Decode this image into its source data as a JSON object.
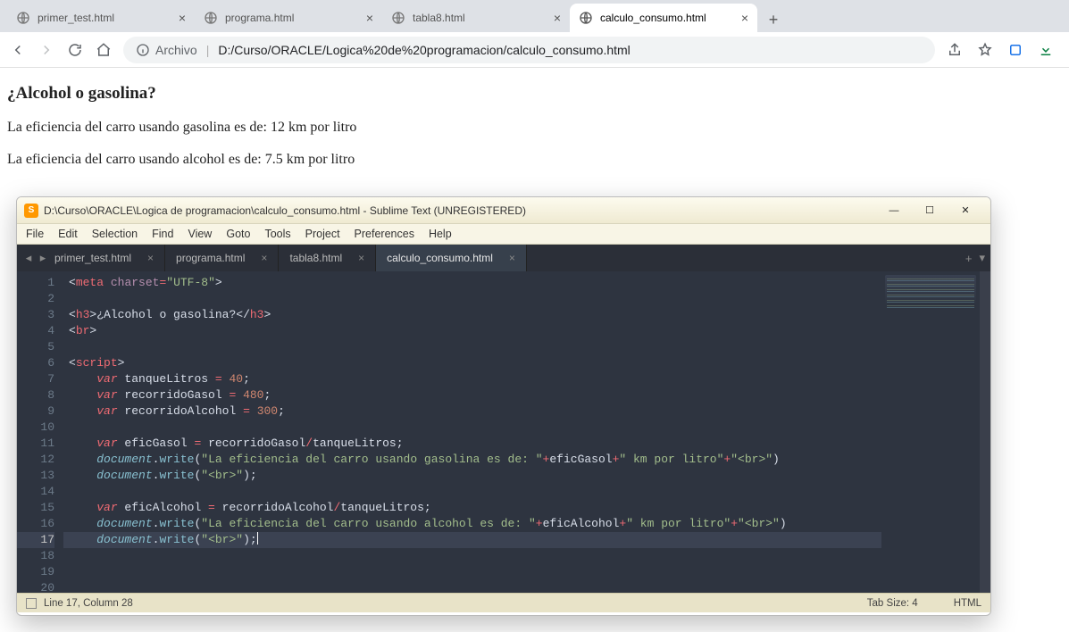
{
  "browser": {
    "tabs": [
      {
        "title": "primer_test.html",
        "active": false
      },
      {
        "title": "programa.html",
        "active": false
      },
      {
        "title": "tabla8.html",
        "active": false
      },
      {
        "title": "calculo_consumo.html",
        "active": true
      }
    ],
    "address_prefix": "Archivo",
    "address_path": "D:/Curso/ORACLE/Logica%20de%20programacion/calculo_consumo.html"
  },
  "page": {
    "heading": "¿Alcohol o gasolina?",
    "line1": "La eficiencia del carro usando gasolina es de: 12 km por litro",
    "line2": "La eficiencia del carro usando alcohol es de: 7.5 km por litro"
  },
  "sublime": {
    "title": "D:\\Curso\\ORACLE\\Logica de programacion\\calculo_consumo.html - Sublime Text (UNREGISTERED)",
    "menu": [
      "File",
      "Edit",
      "Selection",
      "Find",
      "View",
      "Goto",
      "Tools",
      "Project",
      "Preferences",
      "Help"
    ],
    "tabs": [
      {
        "title": "primer_test.html",
        "active": false
      },
      {
        "title": "programa.html",
        "active": false
      },
      {
        "title": "tabla8.html",
        "active": false
      },
      {
        "title": "calculo_consumo.html",
        "active": true
      }
    ],
    "status_left": "Line 17, Column 28",
    "status_tab": "Tab Size: 4",
    "status_lang": "HTML",
    "code": {
      "l1": {
        "a": "<",
        "b": "meta",
        "c": " ",
        "d": "charset",
        "e": "=",
        "f": "\"UTF-8\"",
        "g": ">"
      },
      "l3": {
        "a": "<",
        "b": "h3",
        "c": ">",
        "d": "¿Alcohol o gasolina?",
        "e": "</",
        "f": "h3",
        "g": ">"
      },
      "l4": {
        "a": "<",
        "b": "br",
        "c": ">"
      },
      "l6": {
        "a": "<",
        "b": "script",
        "c": ">"
      },
      "l7": {
        "a": "    ",
        "b": "var",
        "c": " tanqueLitros ",
        "d": "=",
        "e": " ",
        "f": "40",
        "g": ";"
      },
      "l8": {
        "a": "    ",
        "b": "var",
        "c": " recorridoGasol ",
        "d": "=",
        "e": " ",
        "f": "480",
        "g": ";"
      },
      "l9": {
        "a": "    ",
        "b": "var",
        "c": " recorridoAlcohol ",
        "d": "=",
        "e": " ",
        "f": "300",
        "g": ";"
      },
      "l11": {
        "a": "    ",
        "b": "var",
        "c": " eficGasol ",
        "d": "=",
        "e": " recorridoGasol",
        "f": "/",
        "g": "tanqueLitros;"
      },
      "l12": {
        "a": "    ",
        "b": "document",
        "c": ".",
        "d": "write",
        "e": "(",
        "f": "\"La eficiencia del carro usando gasolina es de: \"",
        "g": "+",
        "h": "eficGasol",
        "i": "+",
        "j": "\" km por litro\"",
        "k": "+",
        "l": "\"<br>\"",
        "m": ")"
      },
      "l13": {
        "a": "    ",
        "b": "document",
        "c": ".",
        "d": "write",
        "e": "(",
        "f": "\"<br>\"",
        "g": ");"
      },
      "l15": {
        "a": "    ",
        "b": "var",
        "c": " eficAlcohol ",
        "d": "=",
        "e": " recorridoAlcohol",
        "f": "/",
        "g": "tanqueLitros;"
      },
      "l16": {
        "a": "    ",
        "b": "document",
        "c": ".",
        "d": "write",
        "e": "(",
        "f": "\"La eficiencia del carro usando alcohol es de: \"",
        "g": "+",
        "h": "eficAlcohol",
        "i": "+",
        "j": "\" km por litro\"",
        "k": "+",
        "l": "\"<br>\"",
        "m": ")"
      },
      "l17": {
        "a": "    ",
        "b": "document",
        "c": ".",
        "d": "write",
        "e": "(",
        "f": "\"<br>\"",
        "g": ");"
      }
    },
    "lines": [
      "1",
      "2",
      "3",
      "4",
      "5",
      "6",
      "7",
      "8",
      "9",
      "10",
      "11",
      "12",
      "13",
      "14",
      "15",
      "16",
      "17",
      "18",
      "19",
      "20"
    ]
  }
}
